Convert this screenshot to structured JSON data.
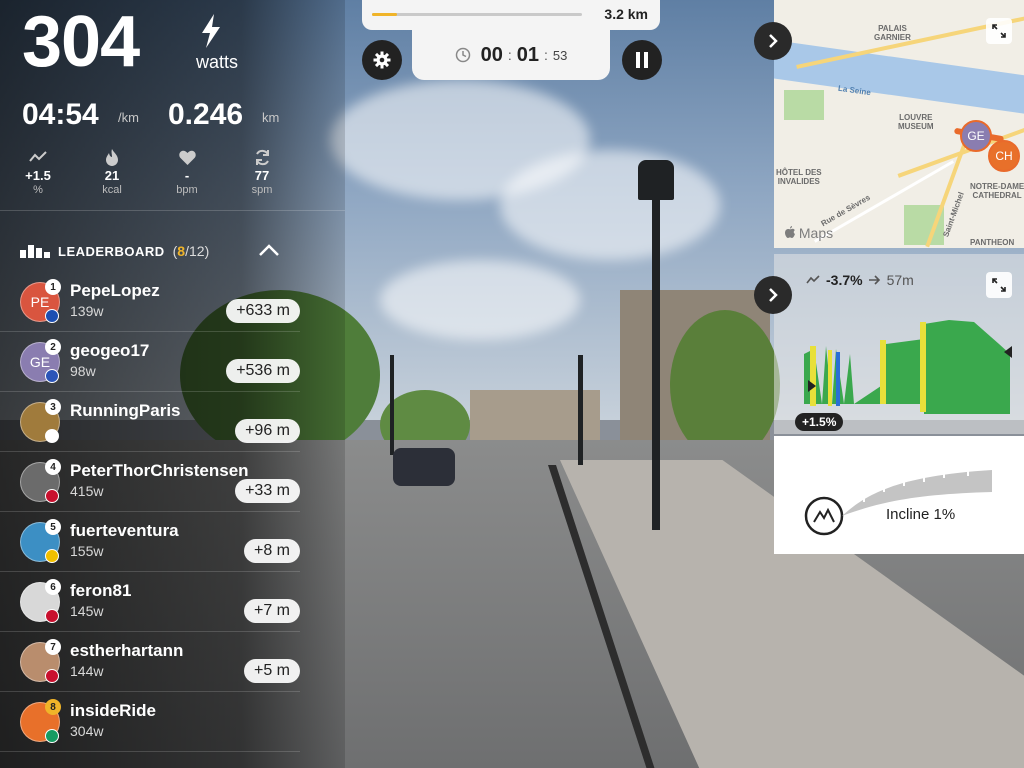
{
  "metrics": {
    "power_value": "304",
    "power_unit": "watts",
    "pace_value": "04:54",
    "pace_unit": "/km",
    "distance_value": "0.246",
    "distance_unit": "km",
    "stats": [
      {
        "icon": "incline-icon",
        "value": "+1.5",
        "unit": "%"
      },
      {
        "icon": "flame-icon",
        "value": "21",
        "unit": "kcal"
      },
      {
        "icon": "heart-icon",
        "value": "-",
        "unit": "bpm"
      },
      {
        "icon": "cadence-icon",
        "value": "77",
        "unit": "spm"
      }
    ]
  },
  "leaderboard": {
    "title": "LEADERBOARD",
    "count_current": "8",
    "count_total": "/12",
    "entries": [
      {
        "rank": "1",
        "initials": "PE",
        "avatar_color": "#d9553f",
        "name": "PepeLopez",
        "watts": "139w",
        "gap": "+633 m"
      },
      {
        "rank": "2",
        "initials": "GE",
        "avatar_color": "#8a7db0",
        "name": "geogeo17",
        "watts": "98w",
        "gap": "+536 m"
      },
      {
        "rank": "3",
        "initials": "",
        "avatar_color": "#a07b3c",
        "name": "RunningParis",
        "watts": "",
        "gap": "+96 m"
      },
      {
        "rank": "4",
        "initials": "",
        "avatar_color": "#6b6b6b",
        "name": "PeterThorChristensen",
        "watts": "415w",
        "gap": "+33 m"
      },
      {
        "rank": "5",
        "initials": "",
        "avatar_color": "#3c8fc4",
        "name": "fuerteventura",
        "watts": "155w",
        "gap": "+8 m"
      },
      {
        "rank": "6",
        "initials": "",
        "avatar_color": "#d8d8d8",
        "name": "feron81",
        "watts": "145w",
        "gap": "+7 m"
      },
      {
        "rank": "7",
        "initials": "",
        "avatar_color": "#b98d6d",
        "name": "estherhartann",
        "watts": "144w",
        "gap": "+5 m"
      },
      {
        "rank": "8",
        "initials": "",
        "avatar_color": "#e8702a",
        "name": "insideRide",
        "watts": "304w",
        "gap": ""
      }
    ]
  },
  "progress": {
    "fraction": 0.12,
    "label": "3.2 km"
  },
  "timer": {
    "hours": "00",
    "minutes": "01",
    "seconds": "53"
  },
  "map": {
    "brand": "Maps",
    "labels": {
      "palais": "PALAIS\nGARNIER",
      "louvre": "LOUVRE\nMUSEUM",
      "invalides": "HÔTEL DES\nINVALIDES",
      "notre_dame": "NOTRE-DAME\nCATHEDRAL",
      "pantheon": "PANTHEON",
      "seine": "La Seine",
      "sevres": "Rue de Sèvres",
      "saint_michel": "Saint-Michel"
    },
    "pins": [
      {
        "initials": "GE",
        "color": "#8a7db0"
      },
      {
        "initials": "CH",
        "color": "#e8702a"
      }
    ]
  },
  "elevation": {
    "grade": "-3.7%",
    "distance": "57m",
    "current_badge": "+1.5%"
  },
  "incline": {
    "label": "Incline 1%"
  },
  "colors": {
    "accent": "#f0b429",
    "elevation_fill": "#3aa84d",
    "elevation_highlight": "#e8e03a",
    "route": "#e96a2b"
  }
}
